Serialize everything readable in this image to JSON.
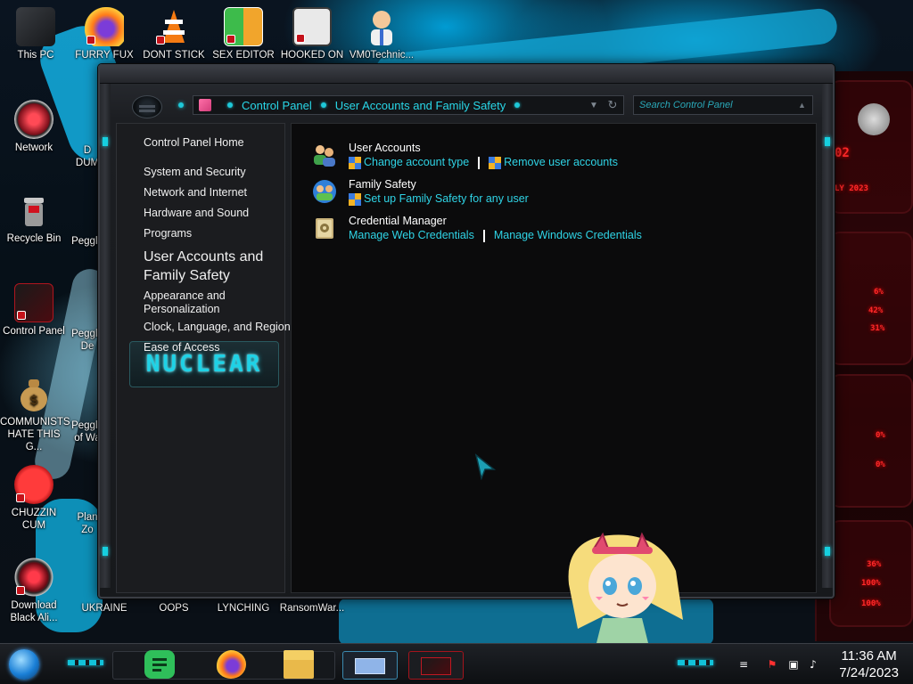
{
  "desktop": {
    "icons": [
      {
        "label": "This PC"
      },
      {
        "label": "FURRY FUX"
      },
      {
        "label": "DONT STICK"
      },
      {
        "label": "SEX EDITOR"
      },
      {
        "label": "HOOKED ON"
      },
      {
        "label": "VM0Technic..."
      },
      {
        "label": "Network"
      },
      {
        "label": "Recycle Bin"
      },
      {
        "label": "Control Panel"
      },
      {
        "label": "COMMUNISTS HATE THIS G..."
      },
      {
        "label": "CHUZZIN CUM"
      },
      {
        "label": "Download Black Ali..."
      },
      {
        "label": "UKRAINE"
      },
      {
        "label": "OOPS"
      },
      {
        "label": "LYNCHING"
      },
      {
        "label": "RansomWar..."
      }
    ],
    "partial_labels": [
      "D",
      "DUM",
      "Peggle",
      "Peggle",
      "De",
      "Peggle",
      "of Wa",
      "Plan",
      "Zo"
    ]
  },
  "window": {
    "address": {
      "crumbs": [
        "Control Panel",
        "User Accounts and Family Safety"
      ]
    },
    "search_placeholder": "Search Control Panel",
    "left_nav": [
      {
        "label": "Control Panel Home"
      },
      {
        "label": "System and Security"
      },
      {
        "label": "Network and Internet"
      },
      {
        "label": "Hardware and Sound"
      },
      {
        "label": "Programs"
      },
      {
        "label": "User Accounts and Family Safety"
      },
      {
        "label": "Appearance and Personalization"
      },
      {
        "label": "Clock, Language, and Region"
      },
      {
        "label": "Ease of Access"
      }
    ],
    "logo_text": "NUCLEAR",
    "categories": [
      {
        "title": "User Accounts",
        "icon": "users-icon",
        "links": [
          {
            "label": "Change account type",
            "shield": true
          },
          {
            "label": "Remove user accounts",
            "shield": true
          }
        ]
      },
      {
        "title": "Family Safety",
        "icon": "family-safety-icon",
        "links": [
          {
            "label": "Set up Family Safety for any user",
            "shield": true
          }
        ]
      },
      {
        "title": "Credential Manager",
        "icon": "credential-vault-icon",
        "links": [
          {
            "label": "Manage Web Credentials",
            "shield": false
          },
          {
            "label": "Manage Windows Credentials",
            "shield": false
          }
        ]
      }
    ]
  },
  "hud": {
    "date_fragment": "LY 2023",
    "number_fragment": "02",
    "percents": [
      "6%",
      "42%",
      "31%",
      "0%",
      "0%",
      "36%",
      "100%",
      "100%"
    ]
  },
  "taskbar": {
    "time": "11:36 AM",
    "date": "7/24/2023"
  },
  "colors": {
    "accent": "#2fd4e6",
    "window_bg": "#0b0b0c",
    "nav_bg": "#1b1c1f",
    "hud_red": "#ff2a2a"
  }
}
